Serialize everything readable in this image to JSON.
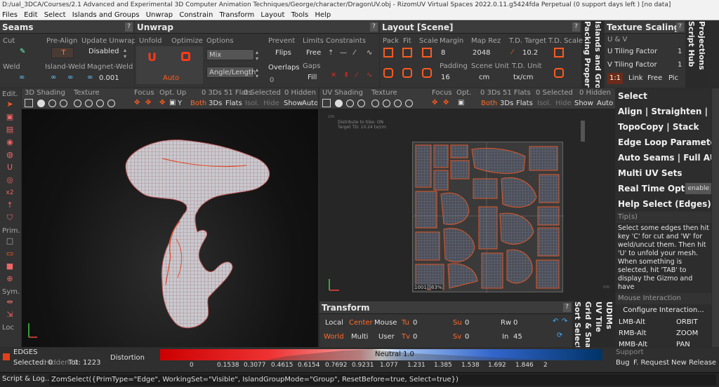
{
  "window": {
    "title": "D:/ual_3DCA/Courses/2.1 Advanced and Experimental 3D Computer Animation Techniques/George/character/DragonUV.obj - RizomUV  Virtual Spaces 2022.0.11.g5424fda Perpetual  (0 support days left ) [no data]"
  },
  "menu": [
    "Files",
    "Edit",
    "Select",
    "Islands and Groups",
    "Unwrap",
    "Constrain",
    "Transform",
    "Layout",
    "Tools",
    "Help"
  ],
  "seams": {
    "title": "Seams",
    "help": "?",
    "cut": "Cut",
    "prealign": "Pre-Align",
    "update_unwrap": "Update Unwrap",
    "prealign_value": "T",
    "update_value": "Disabled",
    "weld": "Weld",
    "island_weld": "Island-Weld",
    "magnet_weld": "Magnet-Weld",
    "magnet_value": "0.001"
  },
  "unwrap": {
    "title": "Unwrap",
    "help": "?",
    "unfold": "Unfold",
    "optimize": "Optimize",
    "options": "Options",
    "mix": "Mix",
    "angle_length": "Angle/Length",
    "auto": "Auto",
    "prevent": "Prevent",
    "flips": "Flips",
    "overlaps": "Overlaps",
    "overlaps_value": "0",
    "limits": "Limits",
    "free": "Free",
    "gaps": "Gaps",
    "fill": "Fill",
    "constraints": "Constraints"
  },
  "layout": {
    "title": "Layout [Scene]",
    "help": "?",
    "pack": "Pack",
    "fit": "Fit",
    "scale": "Scale",
    "margin": "Margin",
    "margin_value": "8",
    "padding": "Padding",
    "padding_value": "16",
    "map_rez": "Map Rez",
    "map_rez_value": "2048",
    "scene_unit": "Scene Unit",
    "scene_unit_value": "cm",
    "td_target": "T.D. Target",
    "td_target_value": "10.2",
    "td_unit": "T.D. Unit",
    "td_unit_value": "tx/cm",
    "td_scale": "T.D. Scale"
  },
  "vtabs": {
    "islands_packing": "Islands and Groups",
    "packing_props": "Packing Properties",
    "script_hub": "Script Hub",
    "projections": "Projections",
    "udims": "UDIMs",
    "uv_tile": "UV Tile",
    "grid_snap": "Grid & Snap",
    "sort_select": "Sort Select"
  },
  "texture_scaling": {
    "title": "Texture Scaling",
    "help": "?",
    "uv": "U & V",
    "u_factor": "U Tiling Factor",
    "u_value": "1",
    "v_factor": "V Tiling Factor",
    "v_value": "1",
    "ratio": "1:1",
    "link": "Link",
    "free": "Free",
    "pic": "Pic"
  },
  "left_toolbar": {
    "edit": "Edit.",
    "prim": "Prim.",
    "sym": "Sym.",
    "loc": "Loc",
    "x2": "x2"
  },
  "view3d": {
    "label": "3D Shading",
    "texture": "Texture",
    "focus": "Focus",
    "optup": "Opt. Up",
    "flats": "0 3Ds 51 Flats",
    "selected": "0 Selected",
    "hidden": "0 Hidden",
    "y": "Y",
    "both": "Both",
    "ds": "3Ds",
    "fl": "Flats",
    "isol": "Isol.",
    "hide": "Hide",
    "show": "Show",
    "auto": "Auto"
  },
  "viewuv": {
    "label": "UV Shading",
    "texture": "Texture",
    "focus": "Focus",
    "opt": "Opt.",
    "flats": "0 3Ds 51 Flats",
    "selected": "0 Selected",
    "hidden": "0 Hidden",
    "both": "Both",
    "ds": "3Ds",
    "fl": "Flats",
    "isol": "Isol.",
    "hide": "Hide",
    "show": "Show",
    "auto": "Auto",
    "info1": "Distribute to tiles: ON",
    "info2": "Target TD: 10.24 tx/cm",
    "tile": "1001",
    "pct": "63%",
    "cm": "cm"
  },
  "transform": {
    "title": "Transform",
    "help": "?",
    "local": "Local",
    "center": "Center",
    "mouse": "Mouse",
    "world": "World",
    "multi": "Multi",
    "user": "User",
    "tu": "Tu",
    "tu_value": "0",
    "tv": "Tv",
    "tv_value": "0",
    "su": "Su",
    "su_value": "0",
    "sv": "Sv",
    "sv_value": "0",
    "rw": "Rw",
    "rw_value": "0",
    "in": "In",
    "in_value": "45"
  },
  "right_panel": {
    "select": "Select",
    "align": "Align | Straighten | Flip",
    "topocopy": "TopoCopy | Stack",
    "edgeloop": "Edge Loop Parameters",
    "autoseams": "Auto Seams | Full AUTO",
    "multiuv": "Multi UV Sets",
    "realtime": "Real Time Optim",
    "enable": "enable",
    "helpsel": "Help Select (Edges)",
    "tips_title": "Tip(s)",
    "tips": "Select some edges then hit key 'C' for cut and 'W' for weld/uncut them. Then hit 'U' to unfold your mesh. When something is selected, hit 'TAB' to display the Gizmo and have",
    "mouse_int": "Mouse Interaction",
    "configure": "Configure Interaction...",
    "lmb": "LMB-Alt",
    "lmb_v": "ORBIT",
    "rmb": "RMB-Alt",
    "rmb_v": "ZOOM",
    "mmb": "MMB-Alt",
    "mmb_v": "PAN"
  },
  "status": {
    "mode": "EDGES",
    "selected": "Selected: 0",
    "hidden": "Hidden: 0",
    "total": "Tot: 1223",
    "distortion": "Distortion",
    "neutral": "Neutral 1.0",
    "ticks": [
      "0",
      "0.1538",
      "0.3077",
      "0.4615",
      "0.6154",
      "0.7692",
      "0.9231",
      "1.077",
      "1.231",
      "1.385",
      "1.538",
      "1.692",
      "1.846",
      "2"
    ],
    "support": "Support",
    "bug": "Bug",
    "request": "F. Request",
    "release": "New Release"
  },
  "script": {
    "label": "Script & Log...",
    "command": "ZomSelect({PrimType=\"Edge\", WorkingSet=\"Visible\", IslandGroupMode=\"Group\", ResetBefore=true, Select=true})"
  },
  "colors": {
    "accent": "#ff5a1f",
    "bg": "#2b2b2b",
    "panel": "#343434"
  }
}
